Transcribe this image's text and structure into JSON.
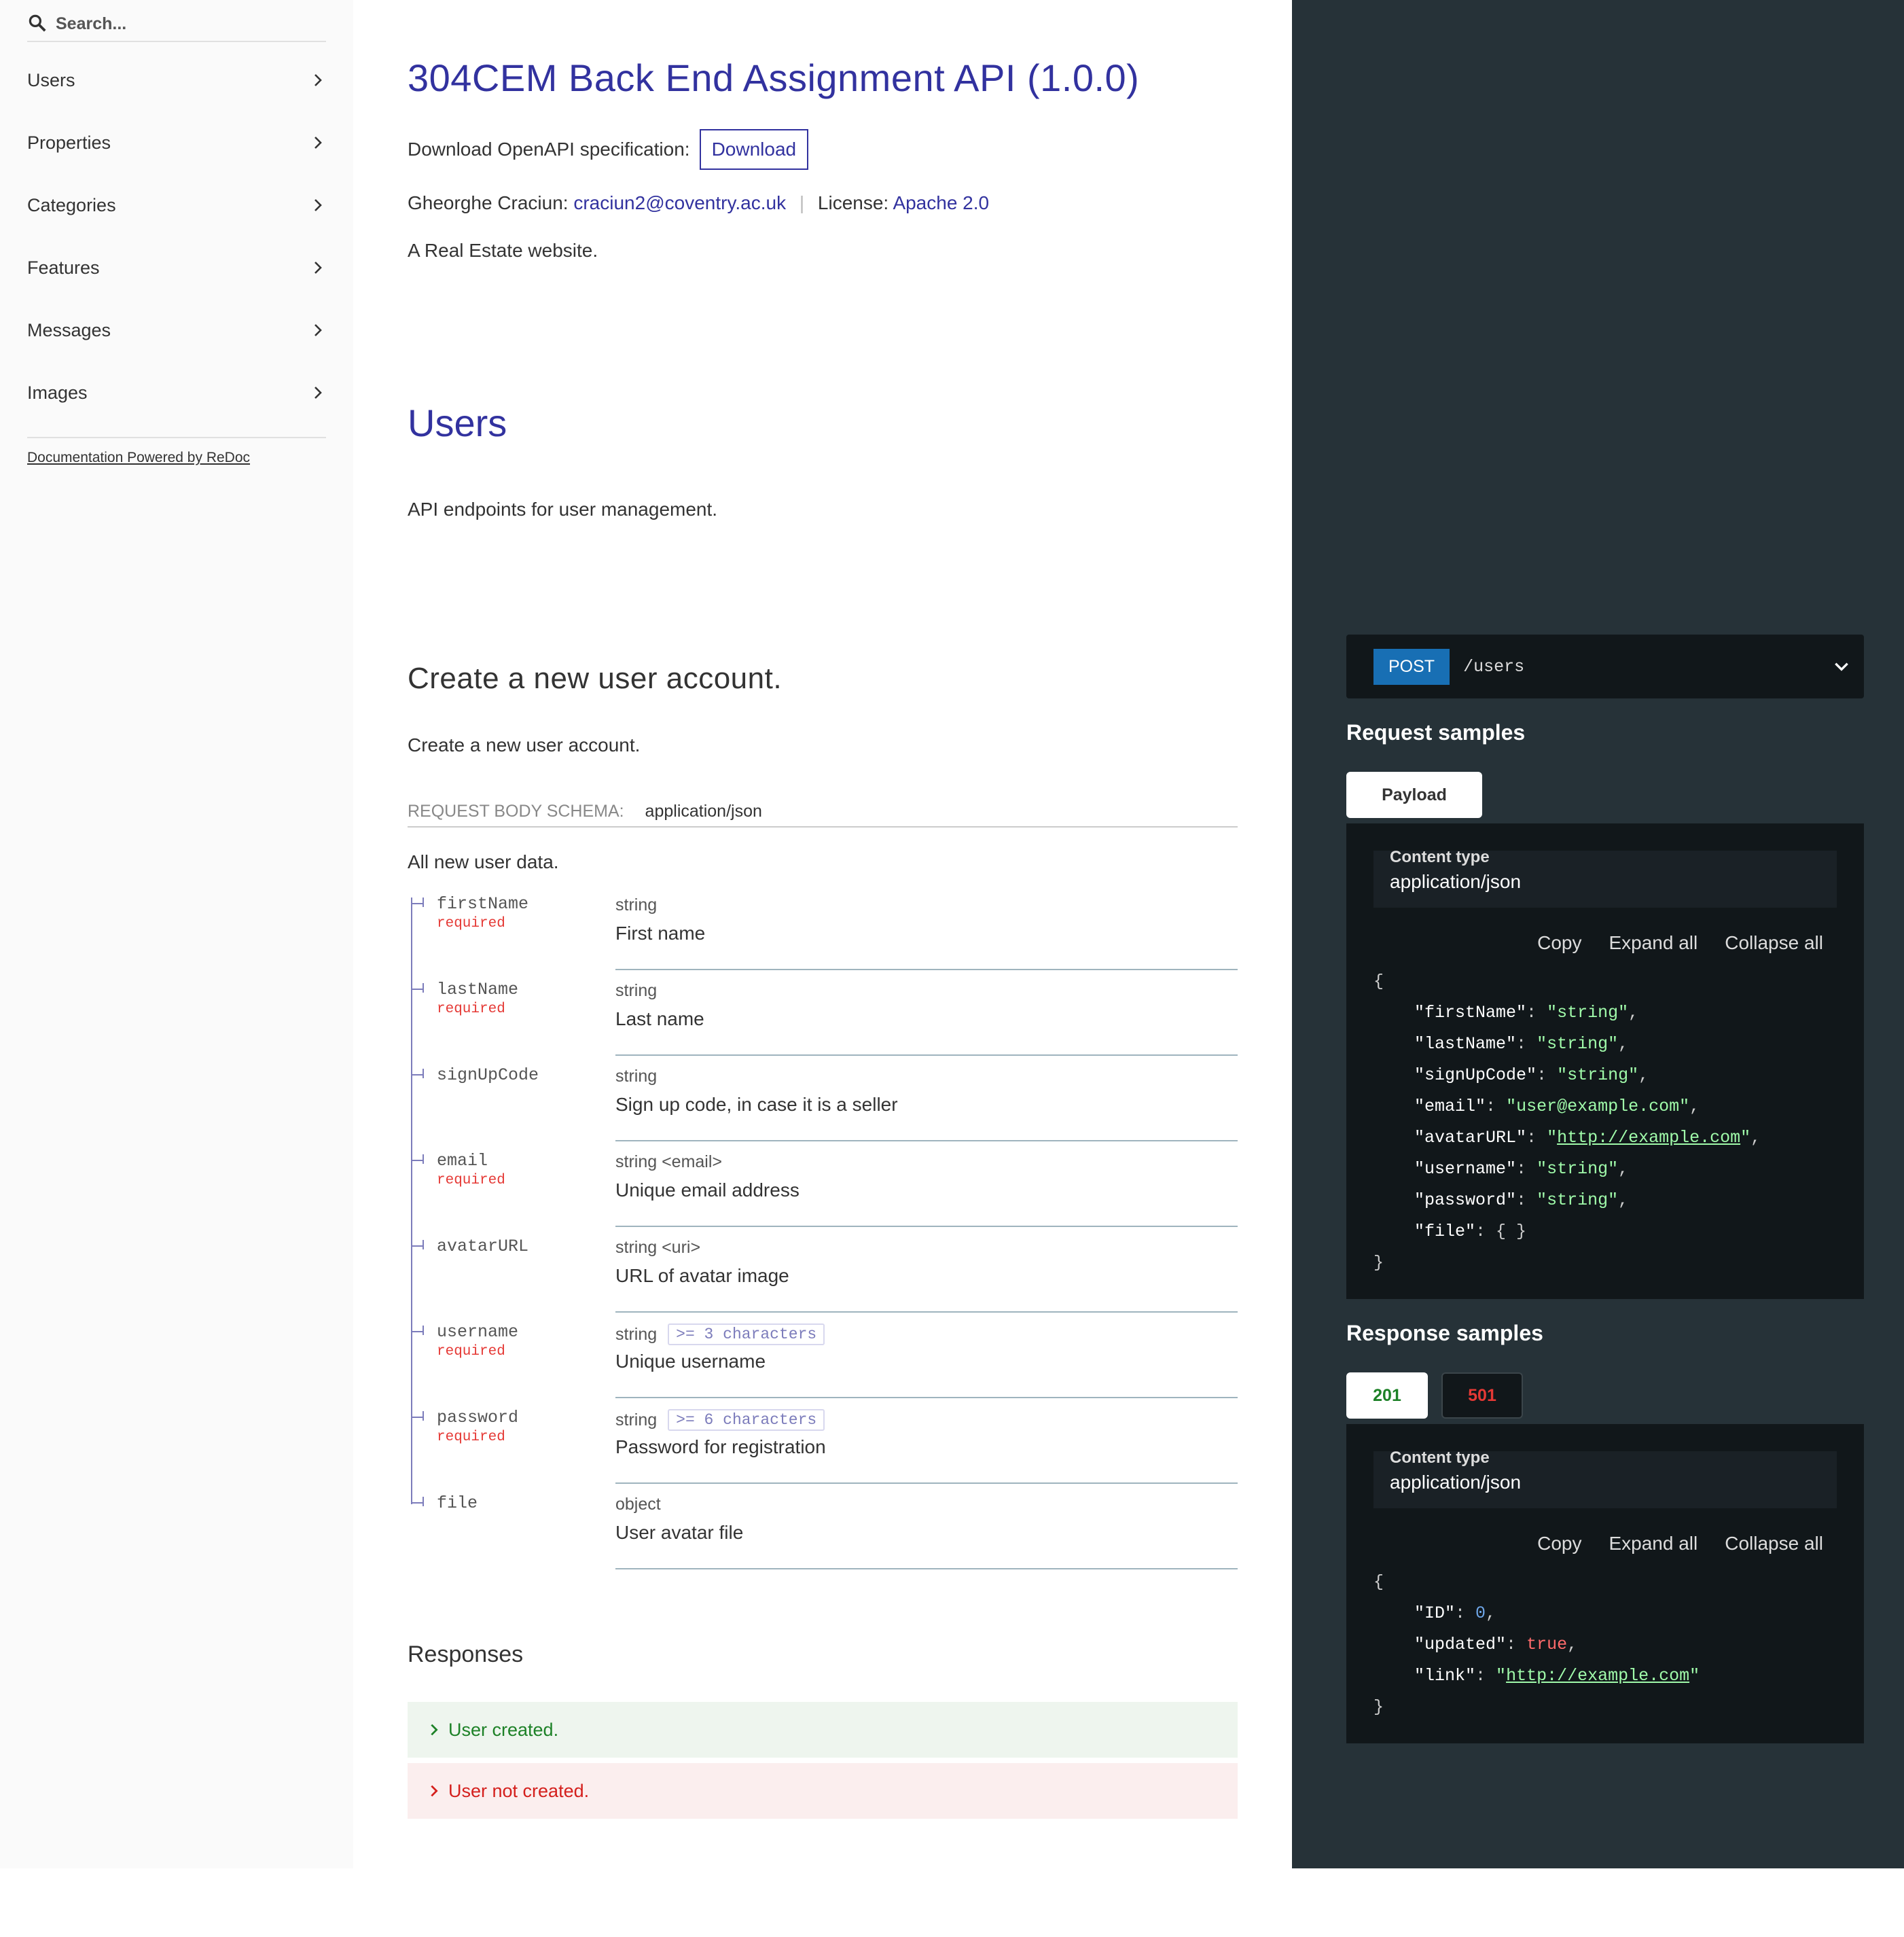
{
  "sidebar": {
    "search_placeholder": "Search...",
    "items": [
      {
        "label": "Users"
      },
      {
        "label": "Properties"
      },
      {
        "label": "Categories"
      },
      {
        "label": "Features"
      },
      {
        "label": "Messages"
      },
      {
        "label": "Images"
      }
    ],
    "powered_by": "Documentation Powered by ReDoc"
  },
  "api": {
    "title": "304CEM Back End Assignment API (1.0.0)",
    "download_label": "Download OpenAPI specification:",
    "download_button": "Download",
    "author": "Gheorghe Craciun:",
    "email": "craciun2@coventry.ac.uk",
    "separator": "|",
    "license_label": "License:",
    "license": "Apache 2.0",
    "description": "A Real Estate website."
  },
  "section": {
    "title": "Users",
    "description": "API endpoints for user management."
  },
  "operation": {
    "title": "Create a new user account.",
    "description": "Create a new user account.",
    "schema_label": "Request Body schema:",
    "media_type": "application/json",
    "body_description": "All new user data.",
    "properties": [
      {
        "name": "firstName",
        "required": "required",
        "type": "string",
        "constraint": "",
        "description": "First name"
      },
      {
        "name": "lastName",
        "required": "required",
        "type": "string",
        "constraint": "",
        "description": "Last name"
      },
      {
        "name": "signUpCode",
        "required": "",
        "type": "string",
        "constraint": "",
        "description": "Sign up code, in case it is a seller"
      },
      {
        "name": "email",
        "required": "required",
        "type": "string <email>",
        "constraint": "",
        "description": "Unique email address"
      },
      {
        "name": "avatarURL",
        "required": "",
        "type": "string <uri>",
        "constraint": "",
        "description": "URL of avatar image"
      },
      {
        "name": "username",
        "required": "required",
        "type": "string",
        "constraint": ">= 3 characters",
        "description": "Unique username"
      },
      {
        "name": "password",
        "required": "required",
        "type": "string",
        "constraint": ">= 6 characters",
        "description": "Password for registration"
      },
      {
        "name": "file",
        "required": "",
        "type": "object",
        "constraint": "",
        "description": "User avatar file"
      }
    ],
    "responses_title": "Responses",
    "responses": [
      {
        "code": "201",
        "text": "User created."
      },
      {
        "code": "501",
        "text": "User not created."
      }
    ]
  },
  "panel": {
    "method": "POST",
    "path": "/users",
    "request_title": "Request samples",
    "payload_tab": "Payload",
    "content_type_label": "Content type",
    "content_type": "application/json",
    "copy": "Copy",
    "expand": "Expand all",
    "collapse": "Collapse all",
    "response_title": "Response samples",
    "tab_201": "201",
    "tab_501": "501"
  },
  "colors": {
    "accent": "#32329f",
    "dark_panel": "#263238",
    "code_bg": "#11171a",
    "method_post": "#186fb4",
    "success": "#1d8127",
    "error": "#d41f1c"
  }
}
